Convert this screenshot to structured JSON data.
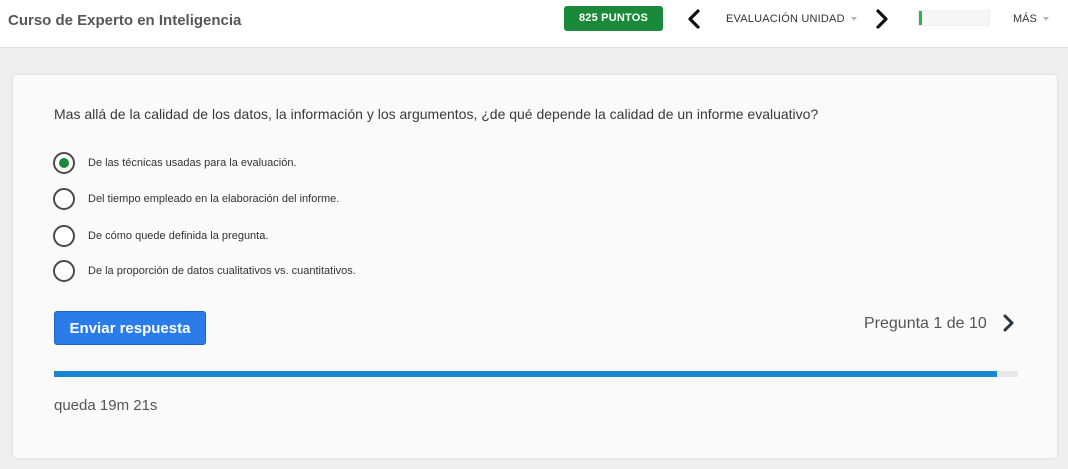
{
  "header": {
    "course_title": "Curso de Experto en Inteligencia",
    "points_label": "825 PUNTOS",
    "prev_icon": "chevron-left-icon",
    "unit_label": "EVALUACIÓN UNIDAD",
    "next_icon": "chevron-right-icon",
    "unit_progress": 0.04,
    "more_label": "MÁS"
  },
  "quiz": {
    "question": "Mas allá de la calidad de los datos, la información y los argumentos, ¿de qué depende la calidad de un informe evaluativo?",
    "options": [
      {
        "label": "De las técnicas usadas para la evaluación.",
        "selected": true
      },
      {
        "label": "Del tiempo empleado en la elaboración del informe.",
        "selected": false
      },
      {
        "label": "De cómo quede definida la pregunta.",
        "selected": false
      },
      {
        "label": "De la proporción de datos cualitativos vs. cuantitativos.",
        "selected": false
      }
    ],
    "submit_label": "Enviar respuesta",
    "counter_text": "Pregunta 1 de 10",
    "time_progress": 0.978,
    "time_left": "queda 19m 21s"
  },
  "colors": {
    "accent_green": "#1a8a3a",
    "button_blue": "#2a7de8",
    "timer_blue": "#1a85d0"
  }
}
